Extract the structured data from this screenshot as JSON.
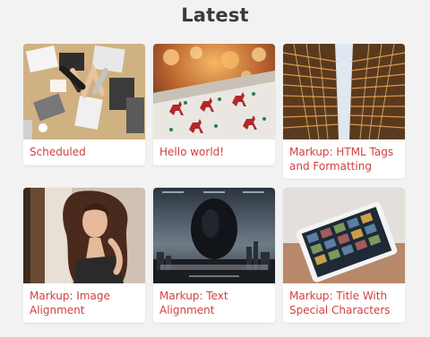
{
  "section": {
    "title": "Latest"
  },
  "posts": [
    {
      "title": "Scheduled",
      "image_icon": "office-desk-photo"
    },
    {
      "title": "Hello world!",
      "image_icon": "christmas-reindeer-photo"
    },
    {
      "title": "Markup: HTML Tags and Formatting",
      "image_icon": "glass-buildings-photo"
    },
    {
      "title": "Markup: Image Alignment",
      "image_icon": "woman-portrait-photo"
    },
    {
      "title": "Markup: Text Alignment",
      "image_icon": "arrival-poster-photo"
    },
    {
      "title": "Markup: Title With Special Characters",
      "image_icon": "tablet-photo"
    }
  ],
  "colors": {
    "link": "#d23f3f",
    "heading": "#3a3a3a",
    "background": "#f2f2f2"
  }
}
